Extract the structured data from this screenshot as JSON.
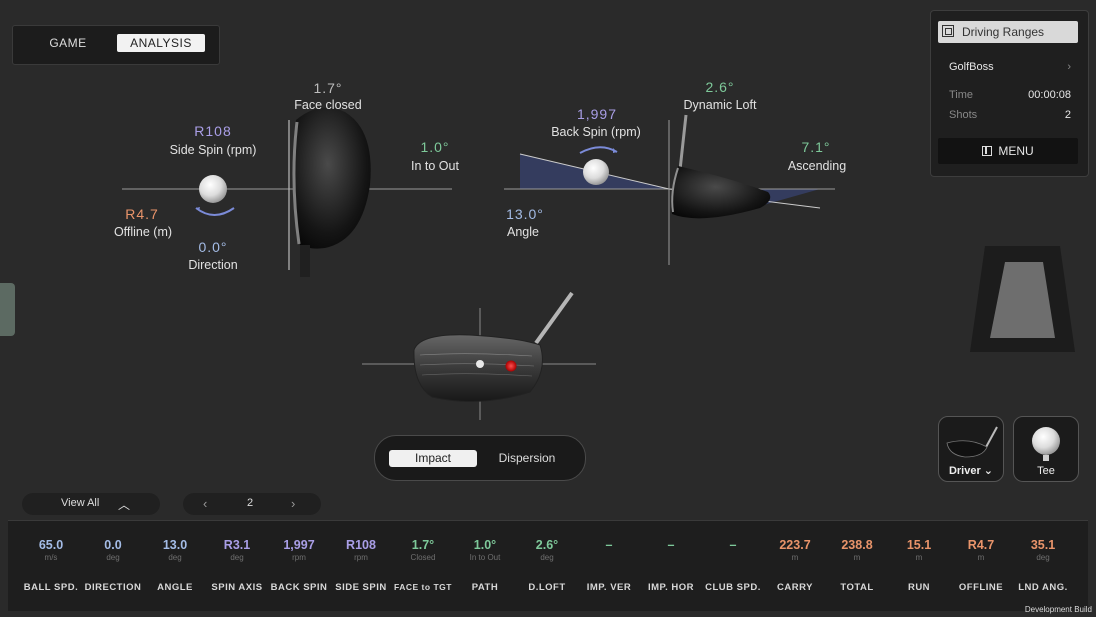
{
  "mode_toggle": {
    "game": "GAME",
    "analysis": "ANALYSIS"
  },
  "panel": {
    "title": "Driving Ranges",
    "user": "GolfBoss",
    "time_label": "Time",
    "time_value": "00:00:08",
    "shots_label": "Shots",
    "shots_value": "2",
    "menu": "MENU"
  },
  "face_view": {
    "face_value": "1.7°",
    "face_label": "Face closed",
    "side_spin_value": "R108",
    "side_spin_label": "Side Spin (rpm)",
    "path_value": "1.0°",
    "path_label": "In to Out",
    "offline_value": "R4.7",
    "offline_label": "Offline (m)",
    "direction_value": "0.0°",
    "direction_label": "Direction"
  },
  "side_view": {
    "back_spin_value": "1,997",
    "back_spin_label": "Back Spin (rpm)",
    "loft_value": "2.6°",
    "loft_label": "Dynamic Loft",
    "attack_value": "7.1°",
    "attack_label": "Ascending",
    "angle_value": "13.0°",
    "angle_label": "Angle"
  },
  "impact_toggle": {
    "impact": "Impact",
    "dispersion": "Dispersion"
  },
  "club_button": "Driver ⌄",
  "tee_button": "Tee",
  "view_all": "View All",
  "page": "2",
  "colors": {
    "purple": "#a99ee6",
    "green": "#7ec99a",
    "orange": "#e9946a",
    "blue": "#a4bce6"
  },
  "stats": [
    {
      "value": "65.0",
      "unit": "m/s",
      "name": "BALL SPD.",
      "color": "#a4bce6"
    },
    {
      "value": "0.0",
      "unit": "deg",
      "name": "DIRECTION",
      "color": "#a4bce6"
    },
    {
      "value": "13.0",
      "unit": "deg",
      "name": "ANGLE",
      "color": "#a4bce6"
    },
    {
      "value": "R3.1",
      "unit": "deg",
      "name": "SPIN AXIS",
      "color": "#a99ee6"
    },
    {
      "value": "1,997",
      "unit": "rpm",
      "name": "BACK SPIN",
      "color": "#a99ee6"
    },
    {
      "value": "R108",
      "unit": "rpm",
      "name": "SIDE SPIN",
      "color": "#a99ee6"
    },
    {
      "value": "1.7°",
      "unit": "Closed",
      "name": "FACE to TGT",
      "color": "#7ec99a"
    },
    {
      "value": "1.0°",
      "unit": "In to Out",
      "name": "PATH",
      "color": "#7ec99a"
    },
    {
      "value": "2.6°",
      "unit": "deg",
      "name": "D.LOFT",
      "color": "#7ec99a"
    },
    {
      "value": "–",
      "unit": "",
      "name": "IMP. VER",
      "color": "#7ec99a"
    },
    {
      "value": "–",
      "unit": "",
      "name": "IMP. HOR",
      "color": "#7ec99a"
    },
    {
      "value": "–",
      "unit": "",
      "name": "CLUB SPD.",
      "color": "#7ec99a"
    },
    {
      "value": "223.7",
      "unit": "m",
      "name": "CARRY",
      "color": "#e9946a"
    },
    {
      "value": "238.8",
      "unit": "m",
      "name": "TOTAL",
      "color": "#e9946a"
    },
    {
      "value": "15.1",
      "unit": "m",
      "name": "RUN",
      "color": "#e9946a"
    },
    {
      "value": "R4.7",
      "unit": "m",
      "name": "OFFLINE",
      "color": "#e9946a"
    },
    {
      "value": "35.1",
      "unit": "deg",
      "name": "LND ANG.",
      "color": "#e9946a"
    }
  ],
  "dev_note": "Development Build"
}
